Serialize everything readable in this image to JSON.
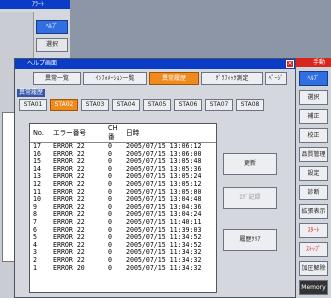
{
  "bg_window": {
    "title": "ｱﾗｰﾄ",
    "buttons": [
      "ﾍﾙﾌﾟ",
      "選択"
    ]
  },
  "window": {
    "title": "ヘルプ画面",
    "close": "×",
    "toolbar": [
      "異常一覧",
      "ｲﾝﾌｫﾒｰｼｮﾝ一覧",
      "異常履歴",
      "ｸﾞﾗﾌｨｯｸ測定",
      "ﾍﾟｰｼﾞ"
    ],
    "section": "異常履歴",
    "tabs": [
      "STA01",
      "STA02",
      "STA03",
      "STA04",
      "STA05",
      "STA06",
      "STA07",
      "STA08"
    ],
    "columns": [
      "No.",
      "エラー番号",
      "CH番",
      "日時"
    ],
    "rows": [
      [
        "17",
        "ERROR 22",
        "0",
        "2005/07/15 13:06:12"
      ],
      [
        "16",
        "ERROR 22",
        "0",
        "2005/07/15 13:06:00"
      ],
      [
        "15",
        "ERROR 22",
        "0",
        "2005/07/15 13:05:48"
      ],
      [
        "14",
        "ERROR 22",
        "0",
        "2005/07/15 13:05:36"
      ],
      [
        "13",
        "ERROR 22",
        "0",
        "2005/07/15 13:05:24"
      ],
      [
        "12",
        "ERROR 22",
        "0",
        "2005/07/15 13:05:12"
      ],
      [
        "11",
        "ERROR 22",
        "0",
        "2005/07/15 13:05:00"
      ],
      [
        "10",
        "ERROR 22",
        "0",
        "2005/07/15 13:04:48"
      ],
      [
        "9",
        "ERROR 22",
        "0",
        "2005/07/15 13:04:36"
      ],
      [
        "8",
        "ERROR 22",
        "0",
        "2005/07/15 13:04:24"
      ],
      [
        "7",
        "ERROR 22",
        "0",
        "2005/07/15 11:40:11"
      ],
      [
        "6",
        "ERROR 22",
        "0",
        "2005/07/15 11:39:03"
      ],
      [
        "5",
        "ERROR 22",
        "0",
        "2005/07/15 11:34:52"
      ],
      [
        "4",
        "ERROR 22",
        "0",
        "2005/07/15 11:34:52"
      ],
      [
        "3",
        "ERROR 22",
        "0",
        "2005/07/15 11:34:32"
      ],
      [
        "2",
        "ERROR 22",
        "0",
        "2005/07/15 11:34:32"
      ],
      [
        "1",
        "ERROR 20",
        "0",
        "2005/07/15 11:34:32"
      ]
    ],
    "actions": [
      "更新",
      "ﾛｸﾞ記録",
      "履歴ｸﾘｱ"
    ]
  },
  "sidebar": {
    "title": "手動",
    "buttons": [
      "ﾍﾙﾌﾟ",
      "選択",
      "補正",
      "校正",
      "品質管理",
      "設定",
      "診断",
      "拡張表示",
      "ｽﾀｰﾄ",
      "ｽﾄｯﾌﾟ",
      "加圧解除",
      "Memory"
    ]
  }
}
